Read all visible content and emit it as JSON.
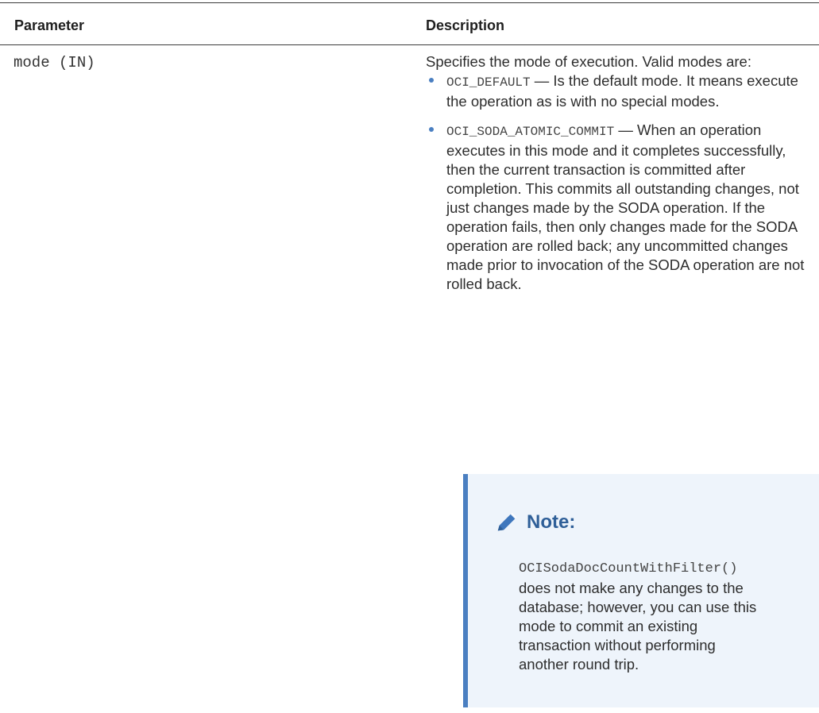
{
  "table": {
    "headers": {
      "parameter": "Parameter",
      "description": "Description"
    },
    "row": {
      "parameter": "mode (IN)",
      "intro": "Specifies the mode of execution. Valid modes are:",
      "modes": [
        {
          "code": "OCI_DEFAULT",
          "text": " — Is the default mode. It means execute the operation as is with no special modes."
        },
        {
          "code": "OCI_SODA_ATOMIC_COMMIT",
          "text": " — When an operation executes in this mode and it completes successfully, then the current transaction is committed after completion. This commits all outstanding changes, not just changes made by the SODA operation. If the operation fails, then only changes made for the SODA operation are rolled back; any uncommitted changes made prior to invocation of the SODA operation are not rolled back."
        }
      ]
    }
  },
  "note": {
    "icon": "pencil-icon",
    "title": "Note:",
    "code": "OCISodaDocCountWithFilter()",
    "text": " does not make any changes to the database; however, you can use this mode to commit an existing transaction without performing another round trip."
  },
  "colors": {
    "accent": "#4a7fc1",
    "note_bg": "#eef4fb",
    "note_title": "#2f5f98"
  }
}
